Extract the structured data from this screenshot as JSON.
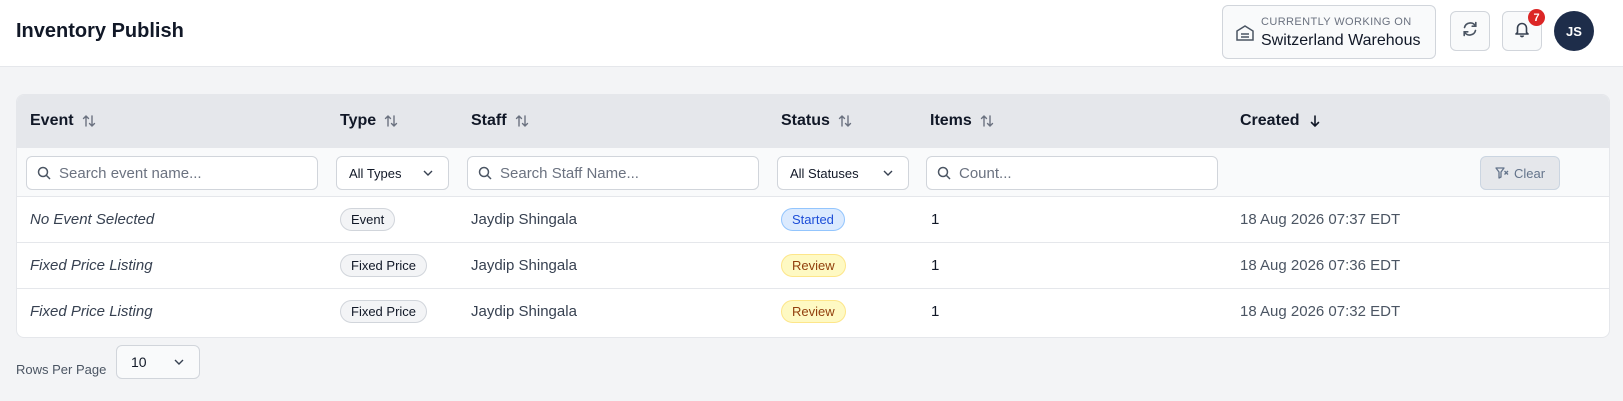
{
  "header": {
    "title": "Inventory Publish",
    "working_on_caption": "Currently Working On",
    "warehouse_name": "Switzerland Warehous",
    "notification_count": "7",
    "avatar_initials": "JS"
  },
  "table": {
    "columns": [
      {
        "label": "Event",
        "sort": "none"
      },
      {
        "label": "Type",
        "sort": "none"
      },
      {
        "label": "Staff",
        "sort": "none"
      },
      {
        "label": "Status",
        "sort": "none"
      },
      {
        "label": "Items",
        "sort": "none"
      },
      {
        "label": "Created",
        "sort": "desc"
      }
    ],
    "filters": {
      "event_placeholder": "Search event name...",
      "type_value": "All Types",
      "staff_placeholder": "Search Staff Name...",
      "status_value": "All Statuses",
      "items_placeholder": "Count...",
      "clear_label": "Clear"
    },
    "rows": [
      {
        "event": "No Event Selected",
        "type": "Event",
        "staff": "Jaydip Shingala",
        "status": "Started",
        "items": "1",
        "created": "18 Aug 2026 07:37 EDT"
      },
      {
        "event": "Fixed Price Listing",
        "type": "Fixed Price",
        "staff": "Jaydip Shingala",
        "status": "Review",
        "items": "1",
        "created": "18 Aug 2026 07:36 EDT"
      },
      {
        "event": "Fixed Price Listing",
        "type": "Fixed Price",
        "staff": "Jaydip Shingala",
        "status": "Review",
        "items": "1",
        "created": "18 Aug 2026 07:32 EDT"
      }
    ]
  },
  "pagination": {
    "rows_per_page_label": "Rows Per Page",
    "rows_per_page_value": "10"
  },
  "colors": {
    "avatar_bg": "#1e2d4a",
    "badge_red": "#dc2626",
    "status_started": "#dbeafe",
    "status_review": "#fef9c3"
  },
  "icons": [
    "warehouse-icon",
    "refresh-icon",
    "bell-icon",
    "sort-icon",
    "sort-down-icon",
    "search-icon",
    "chevron-down-icon",
    "filter-clear-icon"
  ]
}
